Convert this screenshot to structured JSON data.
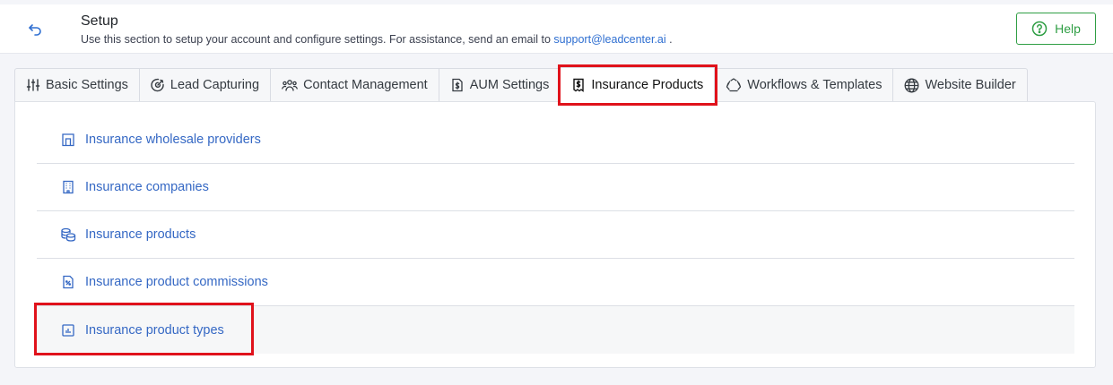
{
  "header": {
    "title": "Setup",
    "subtitle_prefix": "Use this section to setup your account and configure settings. For assistance, send an email to ",
    "support_email": "support@leadcenter.ai",
    "subtitle_suffix": " .",
    "help_label": "Help",
    "accent_color": "#2f9e44"
  },
  "tabs": [
    {
      "label": "Basic Settings",
      "icon": "sliders-icon"
    },
    {
      "label": "Lead Capturing",
      "icon": "target-icon"
    },
    {
      "label": "Contact Management",
      "icon": "people-icon"
    },
    {
      "label": "AUM Settings",
      "icon": "dollar-file-icon"
    },
    {
      "label": "Insurance Products",
      "icon": "dollar-receipt-icon",
      "active": true
    },
    {
      "label": "Workflows & Templates",
      "icon": "cycle-icon"
    },
    {
      "label": "Website Builder",
      "icon": "globe-icon"
    }
  ],
  "items": [
    {
      "label": "Insurance wholesale providers",
      "icon": "bank-icon"
    },
    {
      "label": "Insurance companies",
      "icon": "building-icon"
    },
    {
      "label": "Insurance products",
      "icon": "coins-icon"
    },
    {
      "label": "Insurance product commissions",
      "icon": "file-percent-icon"
    },
    {
      "label": "Insurance product types",
      "icon": "report-icon"
    }
  ],
  "colors": {
    "link": "#3568c4",
    "highlight": "#e0121b"
  }
}
